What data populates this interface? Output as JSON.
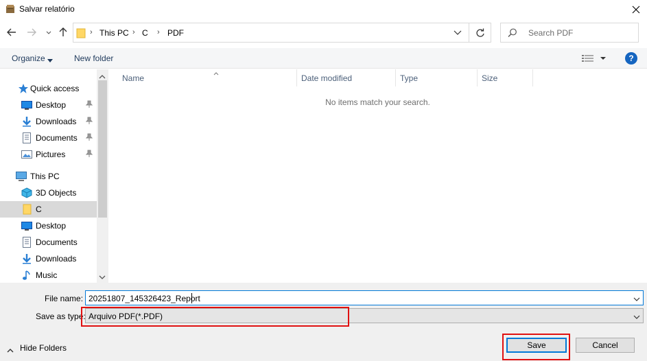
{
  "window": {
    "title": "Salvar relatório"
  },
  "address": {
    "crumbs": [
      "This PC",
      "C",
      "PDF"
    ]
  },
  "search": {
    "placeholder": "Search PDF"
  },
  "toolbar": {
    "organize_label": "Organize",
    "new_folder_label": "New folder",
    "help_label": "?"
  },
  "nav": {
    "quick_access": "Quick access",
    "items": [
      {
        "label": "Desktop",
        "icon": "desktop-icon",
        "pinned": true
      },
      {
        "label": "Downloads",
        "icon": "downloads-icon",
        "pinned": true
      },
      {
        "label": "Documents",
        "icon": "documents-icon",
        "pinned": true
      },
      {
        "label": "Pictures",
        "icon": "pictures-icon",
        "pinned": true
      }
    ],
    "this_pc": "This PC",
    "pc_items": [
      {
        "label": "3D Objects",
        "icon": "3d-objects-icon"
      },
      {
        "label": "C",
        "icon": "folder-icon",
        "selected": true
      },
      {
        "label": "Desktop",
        "icon": "desktop-icon"
      },
      {
        "label": "Documents",
        "icon": "documents-icon"
      },
      {
        "label": "Downloads",
        "icon": "downloads-icon"
      },
      {
        "label": "Music",
        "icon": "music-icon"
      }
    ]
  },
  "columns": {
    "name": "Name",
    "date_modified": "Date modified",
    "type": "Type",
    "size": "Size"
  },
  "content": {
    "empty_message": "No items match your search."
  },
  "form": {
    "file_name_label": "File name:",
    "file_name_value": "20251807_145326423_Report",
    "save_type_label": "Save as type:",
    "save_type_value": "Arquivo PDF(*.PDF)"
  },
  "footer": {
    "hide_folders_label": "Hide Folders",
    "save_label": "Save",
    "cancel_label": "Cancel"
  },
  "colors": {
    "accent": "#0078d7",
    "highlight": "#e01010",
    "help": "#1565c0"
  }
}
